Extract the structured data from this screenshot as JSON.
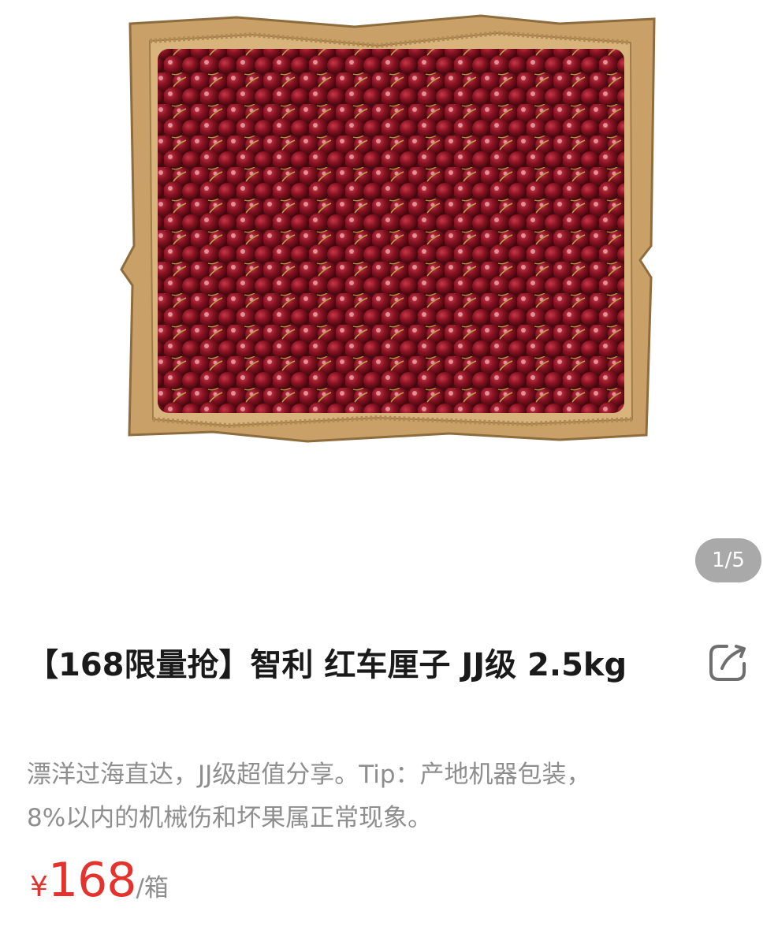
{
  "gallery": {
    "image_alt": "Cherries in a cardboard box",
    "counter": "1/5"
  },
  "product": {
    "title": "【168限量抢】智利 红车厘子 JJ级 2.5kg",
    "description": "漂洋过海直达，JJ级超值分享。Tip：产地机器包装，8%以内的机械伤和坏果属正常现象。",
    "price": {
      "currency": "¥",
      "amount": "168",
      "unit": "/箱"
    }
  },
  "colors": {
    "price": "#e5322d",
    "box": "#c9a168",
    "cherry": "#7a0f1c",
    "counter_bg": "#a9a9a9"
  },
  "icons": {
    "share": "share-icon"
  }
}
